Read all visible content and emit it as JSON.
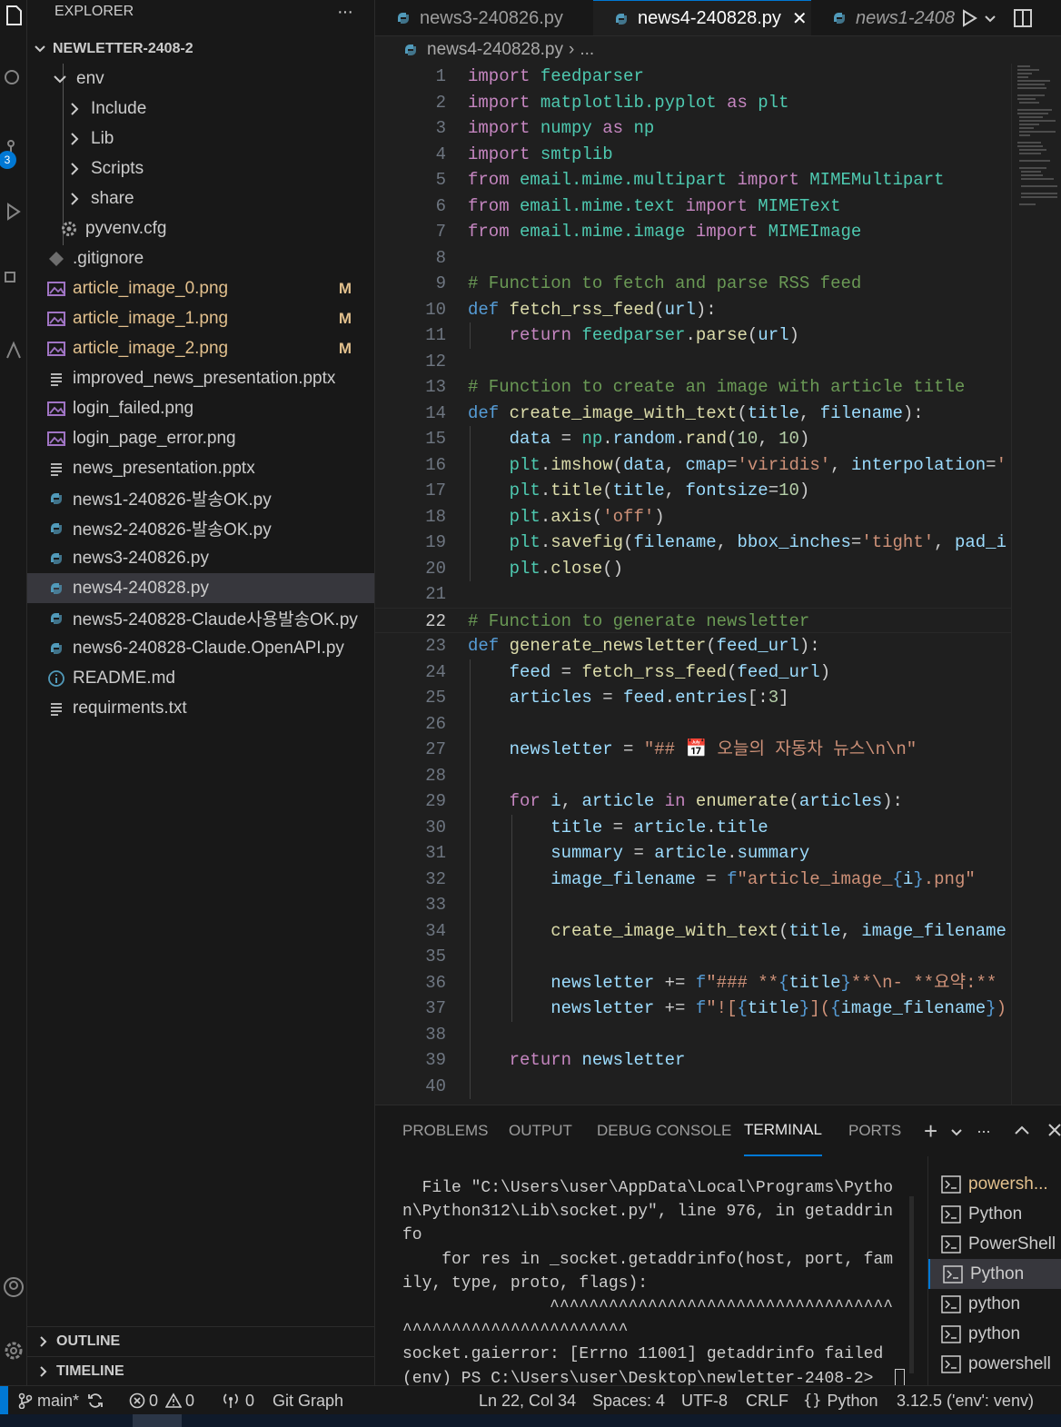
{
  "explorer": {
    "title": "EXPLORER",
    "more": "···",
    "root": "NEWLETTER-2408-2",
    "items": [
      {
        "label": "env",
        "kind": "folder-open"
      },
      {
        "label": "Include",
        "kind": "folder"
      },
      {
        "label": "Lib",
        "kind": "folder"
      },
      {
        "label": "Scripts",
        "kind": "folder"
      },
      {
        "label": "share",
        "kind": "folder"
      },
      {
        "label": "pyvenv.cfg",
        "kind": "gear"
      },
      {
        "label": ".gitignore",
        "kind": "git"
      },
      {
        "label": "article_image_0.png",
        "kind": "image",
        "badge": "M"
      },
      {
        "label": "article_image_1.png",
        "kind": "image",
        "badge": "M"
      },
      {
        "label": "article_image_2.png",
        "kind": "image",
        "badge": "M"
      },
      {
        "label": "improved_news_presentation.pptx",
        "kind": "lines"
      },
      {
        "label": "login_failed.png",
        "kind": "image"
      },
      {
        "label": "login_page_error.png",
        "kind": "image"
      },
      {
        "label": "news_presentation.pptx",
        "kind": "lines"
      },
      {
        "label": "news1-240826-발송OK.py",
        "kind": "python"
      },
      {
        "label": "news2-240826-발송OK.py",
        "kind": "python"
      },
      {
        "label": "news3-240826.py",
        "kind": "python"
      },
      {
        "label": "news4-240828.py",
        "kind": "python"
      },
      {
        "label": "news5-240828-Claude사용발송OK.py",
        "kind": "python"
      },
      {
        "label": "news6-240828-Claude.OpenAPI.py",
        "kind": "python"
      },
      {
        "label": "README.md",
        "kind": "info"
      },
      {
        "label": "requirments.txt",
        "kind": "lines"
      }
    ],
    "outline": "OUTLINE",
    "timeline": "TIMELINE"
  },
  "activity_badge": "3",
  "tabs": [
    {
      "label": "news3-240826.py"
    },
    {
      "label": "news4-240828.py",
      "close": "✕"
    },
    {
      "label": "news1-2408"
    }
  ],
  "breadcrumb": {
    "file": "news4-240828.py",
    "sep": "›",
    "more": "..."
  },
  "code": [
    {
      "n": "1",
      "t": [
        [
          "kw",
          "import "
        ],
        [
          "cls",
          "feedparser"
        ]
      ]
    },
    {
      "n": "2",
      "t": [
        [
          "kw",
          "import "
        ],
        [
          "cls",
          "matplotlib.pyplot"
        ],
        [
          "kw",
          " as "
        ],
        [
          "cls",
          "plt"
        ]
      ]
    },
    {
      "n": "3",
      "t": [
        [
          "kw",
          "import "
        ],
        [
          "cls",
          "numpy"
        ],
        [
          "kw",
          " as "
        ],
        [
          "cls",
          "np"
        ]
      ]
    },
    {
      "n": "4",
      "t": [
        [
          "kw",
          "import "
        ],
        [
          "cls",
          "smtplib"
        ]
      ]
    },
    {
      "n": "5",
      "t": [
        [
          "kw",
          "from "
        ],
        [
          "cls",
          "email.mime.multipart"
        ],
        [
          "kw",
          " import "
        ],
        [
          "cls",
          "MIMEMultipart"
        ]
      ]
    },
    {
      "n": "6",
      "t": [
        [
          "kw",
          "from "
        ],
        [
          "cls",
          "email.mime.text"
        ],
        [
          "kw",
          " import "
        ],
        [
          "cls",
          "MIMEText"
        ]
      ]
    },
    {
      "n": "7",
      "t": [
        [
          "kw",
          "from "
        ],
        [
          "cls",
          "email.mime.image"
        ],
        [
          "kw",
          " import "
        ],
        [
          "cls",
          "MIMEImage"
        ]
      ]
    },
    {
      "n": "8",
      "t": []
    },
    {
      "n": "9",
      "t": [
        [
          "cmt",
          "# Function to fetch and parse RSS feed"
        ]
      ]
    },
    {
      "n": "10",
      "t": [
        [
          "kb",
          "def "
        ],
        [
          "fn",
          "fetch_rss_feed"
        ],
        [
          "",
          "("
        ],
        [
          "var",
          "url"
        ],
        [
          "",
          "):"
        ]
      ]
    },
    {
      "n": "11",
      "t": [
        [
          "",
          "    "
        ],
        [
          "kw",
          "return "
        ],
        [
          "cls",
          "feedparser"
        ],
        [
          "",
          "."
        ],
        [
          "fn",
          "parse"
        ],
        [
          "",
          "("
        ],
        [
          "var",
          "url"
        ],
        [
          "",
          ")"
        ]
      ]
    },
    {
      "n": "12",
      "t": []
    },
    {
      "n": "13",
      "t": [
        [
          "cmt",
          "# Function to create an image with article title"
        ]
      ]
    },
    {
      "n": "14",
      "t": [
        [
          "kb",
          "def "
        ],
        [
          "fn",
          "create_image_with_text"
        ],
        [
          "",
          "("
        ],
        [
          "var",
          "title"
        ],
        [
          "",
          ", "
        ],
        [
          "var",
          "filename"
        ],
        [
          "",
          "):"
        ]
      ]
    },
    {
      "n": "15",
      "t": [
        [
          "",
          "    "
        ],
        [
          "var",
          "data"
        ],
        [
          "",
          " = "
        ],
        [
          "cls",
          "np"
        ],
        [
          "",
          "."
        ],
        [
          "var",
          "random"
        ],
        [
          "",
          "."
        ],
        [
          "fn",
          "rand"
        ],
        [
          "",
          "("
        ],
        [
          "num",
          "10"
        ],
        [
          "",
          ", "
        ],
        [
          "num",
          "10"
        ],
        [
          "",
          ")"
        ]
      ]
    },
    {
      "n": "16",
      "t": [
        [
          "",
          "    "
        ],
        [
          "cls",
          "plt"
        ],
        [
          "",
          "."
        ],
        [
          "fn",
          "imshow"
        ],
        [
          "",
          "("
        ],
        [
          "var",
          "data"
        ],
        [
          "",
          ", "
        ],
        [
          "var",
          "cmap"
        ],
        [
          "",
          "="
        ],
        [
          "str",
          "'viridis'"
        ],
        [
          "",
          ", "
        ],
        [
          "var",
          "interpolation"
        ],
        [
          "",
          "="
        ],
        [
          "str",
          "'"
        ]
      ]
    },
    {
      "n": "17",
      "t": [
        [
          "",
          "    "
        ],
        [
          "cls",
          "plt"
        ],
        [
          "",
          "."
        ],
        [
          "fn",
          "title"
        ],
        [
          "",
          "("
        ],
        [
          "var",
          "title"
        ],
        [
          "",
          ", "
        ],
        [
          "var",
          "fontsize"
        ],
        [
          "",
          "="
        ],
        [
          "num",
          "10"
        ],
        [
          "",
          ")"
        ]
      ]
    },
    {
      "n": "18",
      "t": [
        [
          "",
          "    "
        ],
        [
          "cls",
          "plt"
        ],
        [
          "",
          "."
        ],
        [
          "fn",
          "axis"
        ],
        [
          "",
          "("
        ],
        [
          "str",
          "'off'"
        ],
        [
          "",
          ")"
        ]
      ]
    },
    {
      "n": "19",
      "t": [
        [
          "",
          "    "
        ],
        [
          "cls",
          "plt"
        ],
        [
          "",
          "."
        ],
        [
          "fn",
          "savefig"
        ],
        [
          "",
          "("
        ],
        [
          "var",
          "filename"
        ],
        [
          "",
          ", "
        ],
        [
          "var",
          "bbox_inches"
        ],
        [
          "",
          "="
        ],
        [
          "str",
          "'tight'"
        ],
        [
          "",
          ", "
        ],
        [
          "var",
          "pad_i"
        ]
      ]
    },
    {
      "n": "20",
      "t": [
        [
          "",
          "    "
        ],
        [
          "cls",
          "plt"
        ],
        [
          "",
          "."
        ],
        [
          "fn",
          "close"
        ],
        [
          "",
          "()"
        ]
      ]
    },
    {
      "n": "21",
      "t": []
    },
    {
      "n": "22",
      "t": [
        [
          "cmt",
          "# Function to generate newsletter"
        ]
      ]
    },
    {
      "n": "23",
      "t": [
        [
          "kb",
          "def "
        ],
        [
          "fn",
          "generate_newsletter"
        ],
        [
          "",
          "("
        ],
        [
          "var",
          "feed_url"
        ],
        [
          "",
          "):"
        ]
      ]
    },
    {
      "n": "24",
      "t": [
        [
          "",
          "    "
        ],
        [
          "var",
          "feed"
        ],
        [
          "",
          " = "
        ],
        [
          "fn",
          "fetch_rss_feed"
        ],
        [
          "",
          "("
        ],
        [
          "var",
          "feed_url"
        ],
        [
          "",
          ")"
        ]
      ]
    },
    {
      "n": "25",
      "t": [
        [
          "",
          "    "
        ],
        [
          "var",
          "articles"
        ],
        [
          "",
          " = "
        ],
        [
          "var",
          "feed"
        ],
        [
          "",
          "."
        ],
        [
          "var",
          "entries"
        ],
        [
          "",
          "[:"
        ],
        [
          "num",
          "3"
        ],
        [
          "",
          "]"
        ]
      ]
    },
    {
      "n": "26",
      "t": []
    },
    {
      "n": "27",
      "t": [
        [
          "",
          "    "
        ],
        [
          "var",
          "newsletter"
        ],
        [
          "",
          " = "
        ],
        [
          "str",
          "\"## 📅 오늘의 자동차 뉴스\\n\\n\""
        ]
      ]
    },
    {
      "n": "28",
      "t": []
    },
    {
      "n": "29",
      "t": [
        [
          "",
          "    "
        ],
        [
          "kw",
          "for "
        ],
        [
          "var",
          "i"
        ],
        [
          "",
          ", "
        ],
        [
          "var",
          "article"
        ],
        [
          "kw",
          " in "
        ],
        [
          "fn",
          "enumerate"
        ],
        [
          "",
          "("
        ],
        [
          "var",
          "articles"
        ],
        [
          "",
          "):"
        ]
      ]
    },
    {
      "n": "30",
      "t": [
        [
          "",
          "        "
        ],
        [
          "var",
          "title"
        ],
        [
          "",
          " = "
        ],
        [
          "var",
          "article"
        ],
        [
          "",
          "."
        ],
        [
          "var",
          "title"
        ]
      ]
    },
    {
      "n": "31",
      "t": [
        [
          "",
          "        "
        ],
        [
          "var",
          "summary"
        ],
        [
          "",
          " = "
        ],
        [
          "var",
          "article"
        ],
        [
          "",
          "."
        ],
        [
          "var",
          "summary"
        ]
      ]
    },
    {
      "n": "32",
      "t": [
        [
          "",
          "        "
        ],
        [
          "var",
          "image_filename"
        ],
        [
          "",
          " = "
        ],
        [
          "kb",
          "f"
        ],
        [
          "str",
          "\"article_image_"
        ],
        [
          "kb",
          "{"
        ],
        [
          "var",
          "i"
        ],
        [
          "kb",
          "}"
        ],
        [
          "str",
          ".png\""
        ]
      ]
    },
    {
      "n": "33",
      "t": []
    },
    {
      "n": "34",
      "t": [
        [
          "",
          "        "
        ],
        [
          "fn",
          "create_image_with_text"
        ],
        [
          "",
          "("
        ],
        [
          "var",
          "title"
        ],
        [
          "",
          ", "
        ],
        [
          "var",
          "image_filename"
        ]
      ]
    },
    {
      "n": "35",
      "t": []
    },
    {
      "n": "36",
      "t": [
        [
          "",
          "        "
        ],
        [
          "var",
          "newsletter"
        ],
        [
          "",
          " += "
        ],
        [
          "kb",
          "f"
        ],
        [
          "str",
          "\"### **"
        ],
        [
          "kb",
          "{"
        ],
        [
          "var",
          "title"
        ],
        [
          "kb",
          "}"
        ],
        [
          "str",
          "**\\n- **요약:**"
        ]
      ]
    },
    {
      "n": "37",
      "t": [
        [
          "",
          "        "
        ],
        [
          "var",
          "newsletter"
        ],
        [
          "",
          " += "
        ],
        [
          "kb",
          "f"
        ],
        [
          "str",
          "\"!["
        ],
        [
          "kb",
          "{"
        ],
        [
          "var",
          "title"
        ],
        [
          "kb",
          "}"
        ],
        [
          "str",
          "]("
        ],
        [
          "kb",
          "{"
        ],
        [
          "var",
          "image_filename"
        ],
        [
          "kb",
          "}"
        ],
        [
          "str",
          ")"
        ]
      ]
    },
    {
      "n": "38",
      "t": []
    },
    {
      "n": "39",
      "t": [
        [
          "",
          "    "
        ],
        [
          "kw",
          "return "
        ],
        [
          "var",
          "newsletter"
        ]
      ]
    },
    {
      "n": "40",
      "t": []
    }
  ],
  "current_line": "22",
  "panel": {
    "tabs": [
      "PROBLEMS",
      "OUTPUT",
      "DEBUG CONSOLE",
      "TERMINAL",
      "PORTS"
    ],
    "active_tab": "TERMINAL",
    "actions": {
      "add": "+",
      "more": "···"
    }
  },
  "terminal_lines": [
    "  File \"C:\\Users\\user\\AppData\\Local\\Programs\\Pytho",
    "n\\Python312\\Lib\\socket.py\", line 976, in getaddrin",
    "fo",
    "    for res in _socket.getaddrinfo(host, port, fam",
    "ily, type, proto, flags):",
    "               ^^^^^^^^^^^^^^^^^^^^^^^^^^^^^^^^^^^",
    "^^^^^^^^^^^^^^^^^^^^^^^",
    "socket.gaierror: [Errno 11001] getaddrinfo failed",
    "(env) PS C:\\Users\\user\\Desktop\\newletter-2408-2> "
  ],
  "terminal_list": [
    {
      "label": "powersh...",
      "mod": true
    },
    {
      "label": "Python"
    },
    {
      "label": "PowerShell"
    },
    {
      "label": "Python",
      "selected": true
    },
    {
      "label": "python"
    },
    {
      "label": "python"
    },
    {
      "label": "powershell"
    }
  ],
  "status": {
    "branch": "main*",
    "errors": "0",
    "warnings": "0",
    "ports": "0",
    "git_graph": "Git Graph",
    "position": "Ln 22, Col 34",
    "spaces": "Spaces: 4",
    "encoding": "UTF-8",
    "eol": "CRLF",
    "language": "Python",
    "interpreter": "3.12.5 ('env': venv)"
  },
  "colors": {
    "accent": "#0078d4",
    "modified": "#e2c08d",
    "python_icon": "#519aba",
    "image_icon": "#a074c4"
  }
}
